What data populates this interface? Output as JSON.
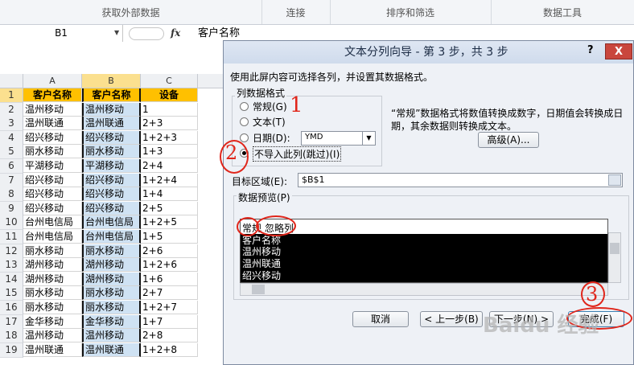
{
  "ribbon": {
    "groups": [
      "获取外部数据",
      "连接",
      "排序和筛选",
      "数据工具"
    ]
  },
  "formula_bar": {
    "name_box": "B1",
    "fx_label": "fx",
    "value": "客户名称"
  },
  "sheet": {
    "columns": [
      "A",
      "B",
      "C"
    ],
    "rows": [
      {
        "num": "1",
        "a": "客户名称",
        "b": "客户名称",
        "c": "设备"
      },
      {
        "num": "2",
        "a": "温州移动",
        "b": "温州移动",
        "c": "1"
      },
      {
        "num": "3",
        "a": "温州联通",
        "b": "温州联通",
        "c": "2+3"
      },
      {
        "num": "4",
        "a": "绍兴移动",
        "b": "绍兴移动",
        "c": "1+2+3"
      },
      {
        "num": "5",
        "a": "丽水移动",
        "b": "丽水移动",
        "c": "1+3"
      },
      {
        "num": "6",
        "a": "平湖移动",
        "b": "平湖移动",
        "c": "2+4"
      },
      {
        "num": "7",
        "a": "绍兴移动",
        "b": "绍兴移动",
        "c": "1+2+4"
      },
      {
        "num": "8",
        "a": "绍兴移动",
        "b": "绍兴移动",
        "c": "1+4"
      },
      {
        "num": "9",
        "a": "绍兴移动",
        "b": "绍兴移动",
        "c": "2+5"
      },
      {
        "num": "10",
        "a": "台州电信局",
        "b": "台州电信局",
        "c": "1+2+5"
      },
      {
        "num": "11",
        "a": "台州电信局",
        "b": "台州电信局",
        "c": "1+5"
      },
      {
        "num": "12",
        "a": "丽水移动",
        "b": "丽水移动",
        "c": "2+6"
      },
      {
        "num": "13",
        "a": "湖州移动",
        "b": "湖州移动",
        "c": "1+2+6"
      },
      {
        "num": "14",
        "a": "湖州移动",
        "b": "湖州移动",
        "c": "1+6"
      },
      {
        "num": "15",
        "a": "丽水移动",
        "b": "丽水移动",
        "c": "2+7"
      },
      {
        "num": "16",
        "a": "丽水移动",
        "b": "丽水移动",
        "c": "1+2+7"
      },
      {
        "num": "17",
        "a": "金华移动",
        "b": "金华移动",
        "c": "1+7"
      },
      {
        "num": "18",
        "a": "温州移动",
        "b": "温州移动",
        "c": "2+8"
      },
      {
        "num": "19",
        "a": "温州联通",
        "b": "温州联通",
        "c": "1+2+8"
      }
    ]
  },
  "dialog": {
    "title": "文本分列向导 - 第 3 步，共 3 步",
    "help": "?",
    "close": "X",
    "instruction": "使用此屏内容可选择各列，并设置其数据格式。",
    "column_format_label": "列数据格式",
    "options": {
      "general": "常规(G)",
      "text": "文本(T)",
      "date": "日期(D):",
      "skip": "不导入此列(跳过)(I)"
    },
    "selected_option": "skip",
    "date_format": "YMD",
    "description": "“常规”数据格式将数值转换成数字，日期值会转换成日期，其余数据则转换成文本。",
    "advanced_button": "高级(A)...",
    "destination_label": "目标区域(E):",
    "destination_value": "$B$1",
    "preview_label": "数据预览(P)",
    "preview_headers": [
      "常规",
      "忽略列"
    ],
    "preview_rows": [
      "客户名称",
      "温州移动",
      "温州联通",
      "绍兴移动"
    ],
    "buttons": {
      "cancel": "取消",
      "back": "< 上一步(B)",
      "next": "下一步(N) >",
      "finish": "完成(F)"
    }
  },
  "annotations": {
    "one": "1",
    "two": "2",
    "three": "3",
    "watermark": "Baidu 经验"
  },
  "colors": {
    "header_fill": "#ffc000",
    "selected_column": "#cfe2f3",
    "annotation": "#e0261b"
  }
}
